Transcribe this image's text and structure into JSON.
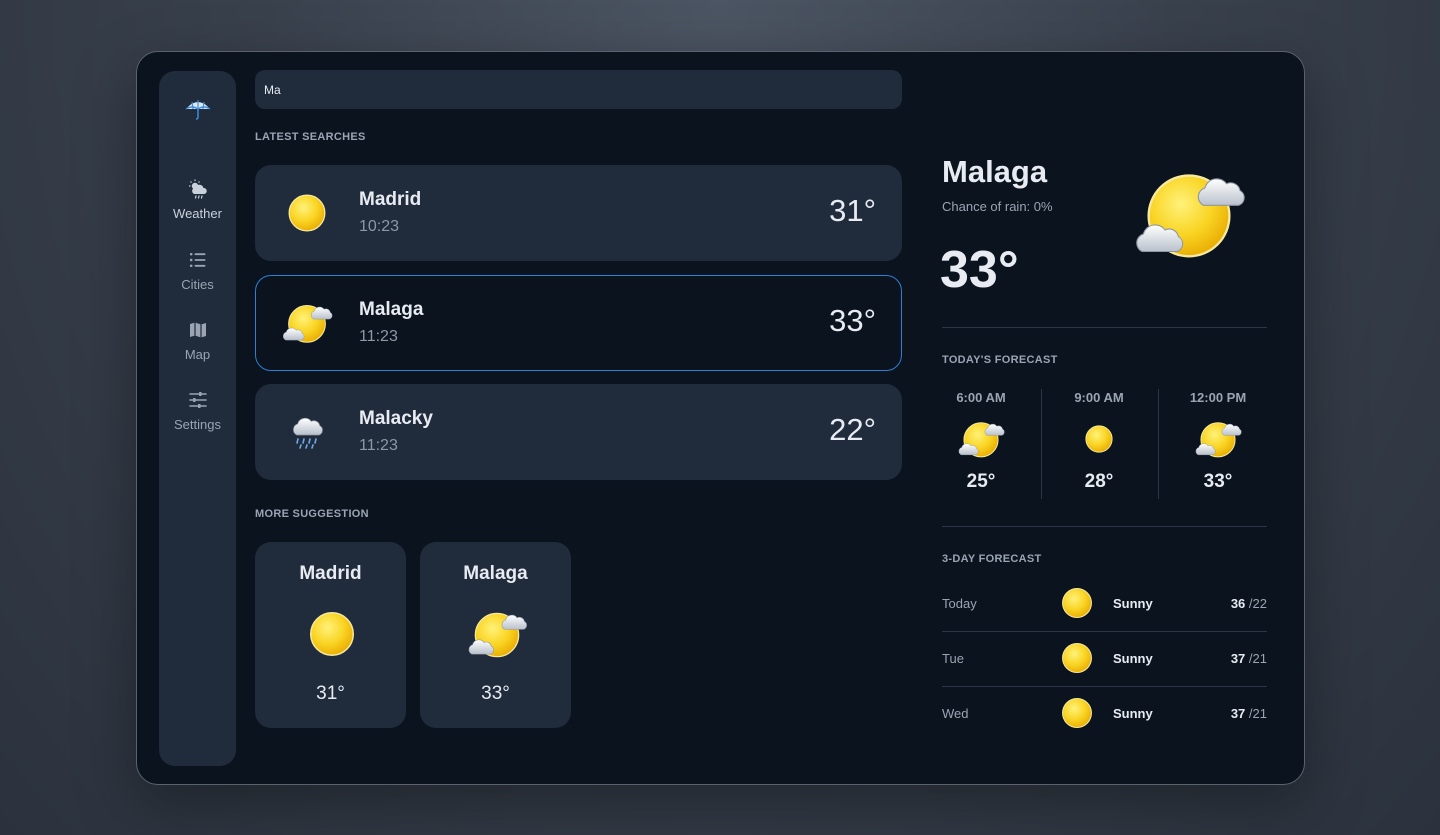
{
  "search": {
    "value": "Ma"
  },
  "sidebar": {
    "logo_icon": "umbrella-icon",
    "items": [
      {
        "label": "Weather",
        "icon": "cloud-sun-rain-icon",
        "active": true
      },
      {
        "label": "Cities",
        "icon": "list-icon",
        "active": false
      },
      {
        "label": "Map",
        "icon": "map-icon",
        "active": false
      },
      {
        "label": "Settings",
        "icon": "sliders-icon",
        "active": false
      }
    ]
  },
  "latest": {
    "title": "LATEST SEARCHES",
    "cities": [
      {
        "name": "Madrid",
        "time": "10:23",
        "temp": "31°",
        "icon": "sun-icon"
      },
      {
        "name": "Malaga",
        "time": "11:23",
        "temp": "33°",
        "icon": "sun-cloud-icon",
        "selected": true
      },
      {
        "name": "Malacky",
        "time": "11:23",
        "temp": "22°",
        "icon": "cloud-rain-icon"
      }
    ]
  },
  "suggestions": {
    "title": "MORE SUGGESTION",
    "items": [
      {
        "name": "Madrid",
        "temp": "31°",
        "icon": "sun-icon"
      },
      {
        "name": "Malaga",
        "temp": "33°",
        "icon": "sun-cloud-icon"
      }
    ]
  },
  "current": {
    "city": "Malaga",
    "rain": "Chance of rain: 0%",
    "temp": "33°",
    "icon": "sun-cloud-icon"
  },
  "today": {
    "title": "TODAY'S FORECAST",
    "hours": [
      {
        "time": "6:00 AM",
        "temp": "25°",
        "icon": "sun-cloud-icon"
      },
      {
        "time": "9:00 AM",
        "temp": "28°",
        "icon": "sun-icon"
      },
      {
        "time": "12:00 PM",
        "temp": "33°",
        "icon": "sun-cloud-icon"
      }
    ]
  },
  "three_day": {
    "title": "3-DAY FORECAST",
    "days": [
      {
        "day": "Today",
        "cond": "Sunny",
        "high": "36",
        "low": "/22",
        "icon": "sun-icon"
      },
      {
        "day": "Tue",
        "cond": "Sunny",
        "high": "37",
        "low": "/21",
        "icon": "sun-icon"
      },
      {
        "day": "Wed",
        "cond": "Sunny",
        "high": "37",
        "low": "/21",
        "icon": "sun-icon"
      }
    ]
  },
  "colors": {
    "background": "#0b131e",
    "card": "#202b3b",
    "accent": "#2f7fd6",
    "sun": "#f9d423",
    "muted": "#9aa4b2"
  }
}
